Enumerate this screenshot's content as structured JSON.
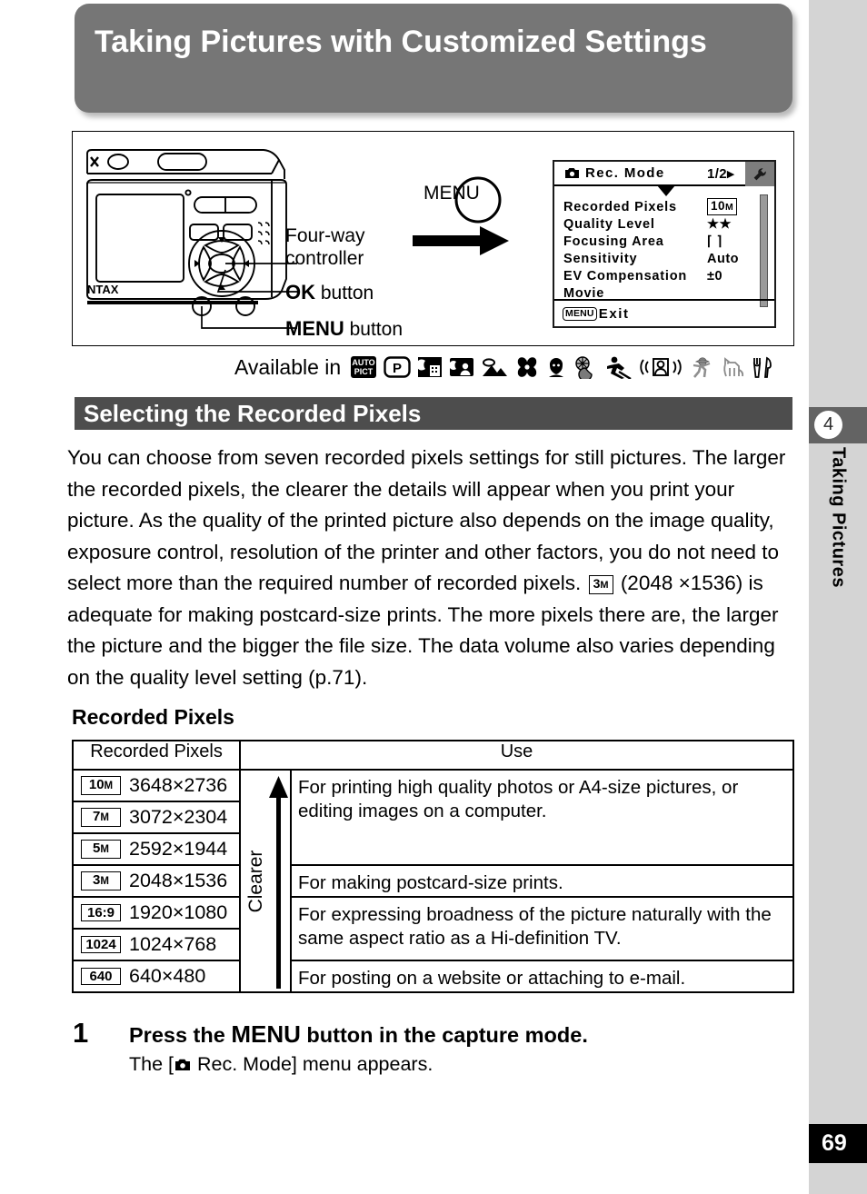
{
  "document": {
    "title": "Taking Pictures with Customized Settings",
    "page_number": "69",
    "chapter_number": "4",
    "chapter_title": "Taking Pictures"
  },
  "figure": {
    "callouts": {
      "four_way_line1": "Four-way",
      "four_way_line2": "controller",
      "ok_button_bold": "OK",
      "ok_button_rest": " button",
      "menu_button_bold": "MENU",
      "menu_button_rest": " button",
      "menu_press_label": "MENU"
    },
    "camera_brand": "NTAX"
  },
  "lcd": {
    "title": "Rec. Mode",
    "page_indicator": "1/2",
    "camera_icon": "camera-icon",
    "wrench_icon": "wrench-icon",
    "rows": [
      {
        "name": "Recorded Pixels",
        "value": "10M",
        "boxed": true
      },
      {
        "name": "Quality Level",
        "value": "★★",
        "boxed": false
      },
      {
        "name": "Focusing Area",
        "value": "⌈    ⌉",
        "boxed": false
      },
      {
        "name": "Sensitivity",
        "value": "Auto",
        "boxed": false
      },
      {
        "name": "EV Compensation",
        "value": "±0",
        "boxed": false
      },
      {
        "name": "Movie",
        "value": "",
        "boxed": false
      }
    ],
    "exit_key": "MENU",
    "exit_label": "Exit"
  },
  "available_in": {
    "label": "Available in",
    "modes": [
      "auto-pict-mode-icon",
      "program-mode-icon",
      "night-scene-mode-icon",
      "night-scene-portrait-mode-icon",
      "landscape-mode-icon",
      "flower-mode-icon",
      "portrait-mode-icon",
      "surf-and-snow-mode-icon",
      "sport-mode-icon",
      "frame-composite-mode-icon",
      "kids-mode-icon",
      "pet-mode-icon",
      "food-mode-icon"
    ]
  },
  "section": {
    "heading": "Selecting the Recorded Pixels"
  },
  "body": {
    "part1": "You can choose from seven recorded pixels settings for still pictures. The larger the recorded pixels, the clearer the details will appear when you print your picture. As the quality of the printed picture also depends on the image quality, exposure control, resolution of the printer and other factors, you do not need to select more than the required number of recorded pixels.",
    "inline_badge": "3M",
    "part2": "(2048 ×1536) is adequate for making postcard-size prints. The more pixels there are, the larger the picture and the bigger the file size. The data volume also varies depending on the quality level setting (p.71)."
  },
  "table": {
    "subhead": "Recorded Pixels",
    "headers": {
      "pixels": "Recorded Pixels",
      "use": "Use"
    },
    "arrow_label": "Clearer",
    "rows": [
      {
        "badge": "10M",
        "dimensions": "3648×2736"
      },
      {
        "badge": "7M",
        "dimensions": "3072×2304"
      },
      {
        "badge": "5M",
        "dimensions": "2592×1944"
      },
      {
        "badge": "3M",
        "dimensions": "2048×1536"
      },
      {
        "badge": "16:9",
        "dimensions": "1920×1080"
      },
      {
        "badge": "1024",
        "dimensions": "1024×768"
      },
      {
        "badge": "640",
        "dimensions": "640×480"
      }
    ],
    "uses": [
      "For printing high quality photos or A4-size pictures, or editing images on a computer.",
      "For making postcard-size prints.",
      "For expressing broadness of the picture naturally with the same aspect ratio as a Hi-definition TV.",
      "For posting on a website or attaching to e-mail."
    ]
  },
  "step": {
    "number": "1",
    "title_before": "Press the ",
    "title_menu": "MENU",
    "title_after": " button in the capture mode.",
    "sub_before": "The [",
    "sub_after": " Rec. Mode] menu appears."
  }
}
